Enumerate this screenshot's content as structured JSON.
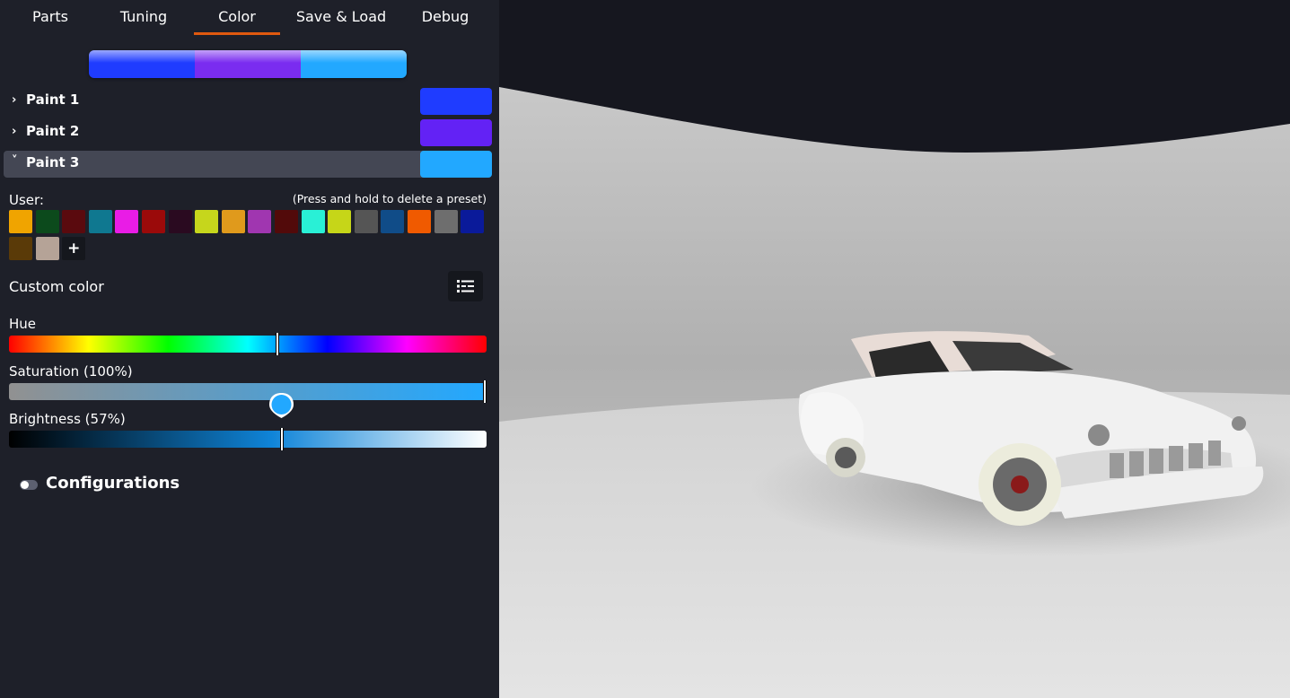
{
  "tabs": [
    {
      "label": "Parts",
      "active": false
    },
    {
      "label": "Tuning",
      "active": false
    },
    {
      "label": "Color",
      "active": true
    },
    {
      "label": "Save & Load",
      "active": false
    },
    {
      "label": "Debug",
      "active": false
    }
  ],
  "preview_colors": [
    "#1f3cff",
    "#7a2cf0",
    "#22a8ff"
  ],
  "paints": [
    {
      "label": "Paint 1",
      "color": "#1f3cff",
      "expanded": false
    },
    {
      "label": "Paint 2",
      "color": "#6322f5",
      "expanded": false
    },
    {
      "label": "Paint 3",
      "color": "#22a8ff",
      "expanded": true
    }
  ],
  "user_presets": {
    "label": "User:",
    "hint": "(Press and hold to delete a preset)",
    "colors": [
      "#f0a400",
      "#0c4a1c",
      "#5a0a0e",
      "#0f7890",
      "#e91ce6",
      "#9b0a0a",
      "#2a0a20",
      "#c6d61c",
      "#e09a1c",
      "#a036b0",
      "#520a0a",
      "#29f0d6",
      "#c6d618",
      "#555555",
      "#104c88",
      "#f05a00",
      "#6e6e6e",
      "#0a1a9a",
      "#5a3a08",
      "#b5a397"
    ],
    "add_icon": "plus-icon"
  },
  "custom_color": {
    "label": "Custom color",
    "icon": "list-settings-icon"
  },
  "sliders": {
    "hue": {
      "label": "Hue",
      "value": 0.56
    },
    "saturation": {
      "label": "Saturation (100%)",
      "value": 1.0
    },
    "brightness": {
      "label": "Brightness (57%)",
      "value": 0.57
    }
  },
  "configurations": {
    "label": "Configurations",
    "enabled": false
  }
}
